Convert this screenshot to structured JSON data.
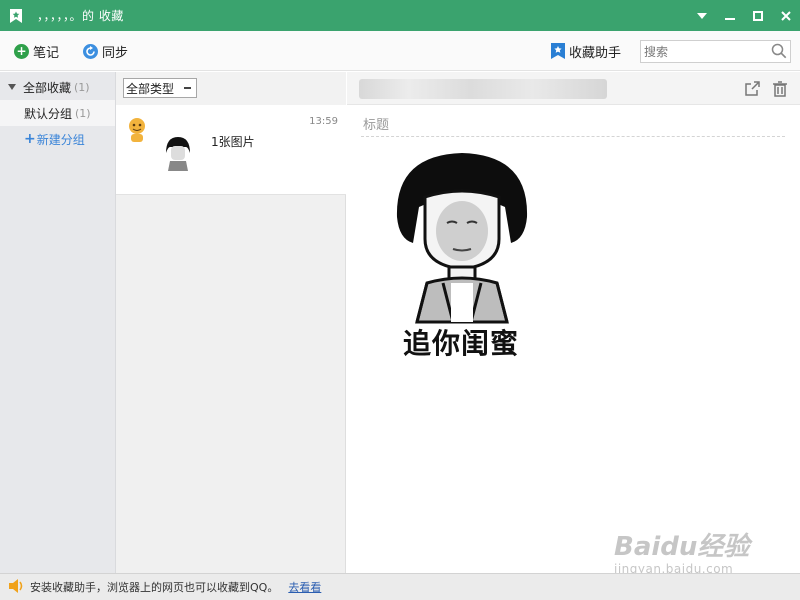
{
  "window": {
    "title": "，，，，，。的 收藏",
    "accent_color": "#3aa36e"
  },
  "toolbar": {
    "note_label": "笔记",
    "sync_label": "同步",
    "assistant_label": "收藏助手",
    "search_placeholder": "搜索"
  },
  "sidebar": {
    "root": {
      "label": "全部收藏",
      "count": "(1)"
    },
    "items": [
      {
        "label": "默认分组",
        "count": "(1)"
      }
    ],
    "new_group_label": "新建分组"
  },
  "list": {
    "filter_value": "全部类型",
    "items": [
      {
        "time": "13:59",
        "text": "1张图片"
      }
    ]
  },
  "detail": {
    "title_placeholder": "标题",
    "image_caption": "追你闺蜜"
  },
  "statusbar": {
    "message": "安装收藏助手，浏览器上的网页也可以收藏到QQ。",
    "link_label": "去看看"
  },
  "watermark": {
    "main": "Baidu经验",
    "sub": "jingyan.baidu.com"
  },
  "icons": [
    "bookmark-star-icon",
    "dropdown-icon",
    "minimize-icon",
    "maximize-icon",
    "close-icon",
    "plus-icon",
    "sync-icon",
    "star-icon",
    "search-icon",
    "share-icon",
    "trash-icon",
    "speaker-icon"
  ]
}
